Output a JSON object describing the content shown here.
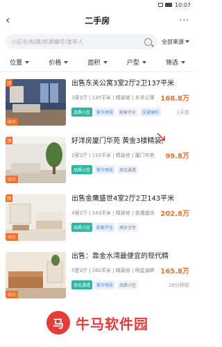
{
  "status_bar": {
    "time": "10:07"
  },
  "header": {
    "title": "二手房",
    "more_icon": "more-dots-icon",
    "back_icon": "back-arrow-icon"
  },
  "search": {
    "placeholder": "小区名/标题/房源编号/发布人",
    "source_label": "全部来源"
  },
  "filters": [
    "位置",
    "价格",
    "面积",
    "户型",
    "筛选"
  ],
  "listings": [
    {
      "title": "出售东关公寓3室2厅2卫137平米",
      "meta": "3室2厅 | 137平米 | 精装修 | 东关公寓",
      "price": "168.8万",
      "top_tag": "顶",
      "bottom_tag": "中介",
      "badges": [
        {
          "text": "品质小区",
          "style": "green"
        },
        {
          "text": "繁华地段",
          "style": "blue"
        },
        {
          "text": "配套齐全",
          "style": "gray"
        },
        {
          "text": "交通便利",
          "style": "blue"
        }
      ],
      "time": "1天前"
    },
    {
      "title": "好洋房厦门华苑 黄金3楼精装,",
      "meta": "3室2厅 | 110平米 | 精装修 | 厦门华苑",
      "price": "99.8万",
      "top_tag": "顶",
      "bottom_tag": "中介",
      "badges": [
        {
          "text": "品质小区",
          "style": "green"
        },
        {
          "text": "繁华地段",
          "style": "blue"
        },
        {
          "text": "南北通透",
          "style": "gray"
        }
      ],
      "time": ""
    },
    {
      "title": "出售金鹰盛世4室2厅2卫143平米",
      "meta": "4室2厅 | 143平米 | 精装修 | 金鹰盛世",
      "price": "202.8万",
      "top_tag": "顶",
      "bottom_tag": "中介",
      "badges": [
        {
          "text": "品质小区",
          "style": "green"
        },
        {
          "text": "配套齐全",
          "style": "blue"
        },
        {
          "text": "高安全性",
          "style": "gray"
        }
      ],
      "time": ""
    },
    {
      "title": "出售：靠金水湾最便宜的现代精",
      "meta": "5室2厅 | 260平米 | 精装修 | 明星湖畔",
      "price": "165.8万",
      "top_tag": "",
      "bottom_tag": "中介",
      "badges": [
        {
          "text": "南北通透",
          "style": "green"
        },
        {
          "text": "繁华地段",
          "style": "blue"
        },
        {
          "text": "品质小区",
          "style": "gray"
        }
      ],
      "time": "29分钟前"
    }
  ],
  "watermark": {
    "text": "牛马软件园",
    "logo_glyph": "马"
  },
  "colors": {
    "accent": "#f2702a",
    "green": "#2db7a0",
    "brand_red": "#e63b3b"
  }
}
